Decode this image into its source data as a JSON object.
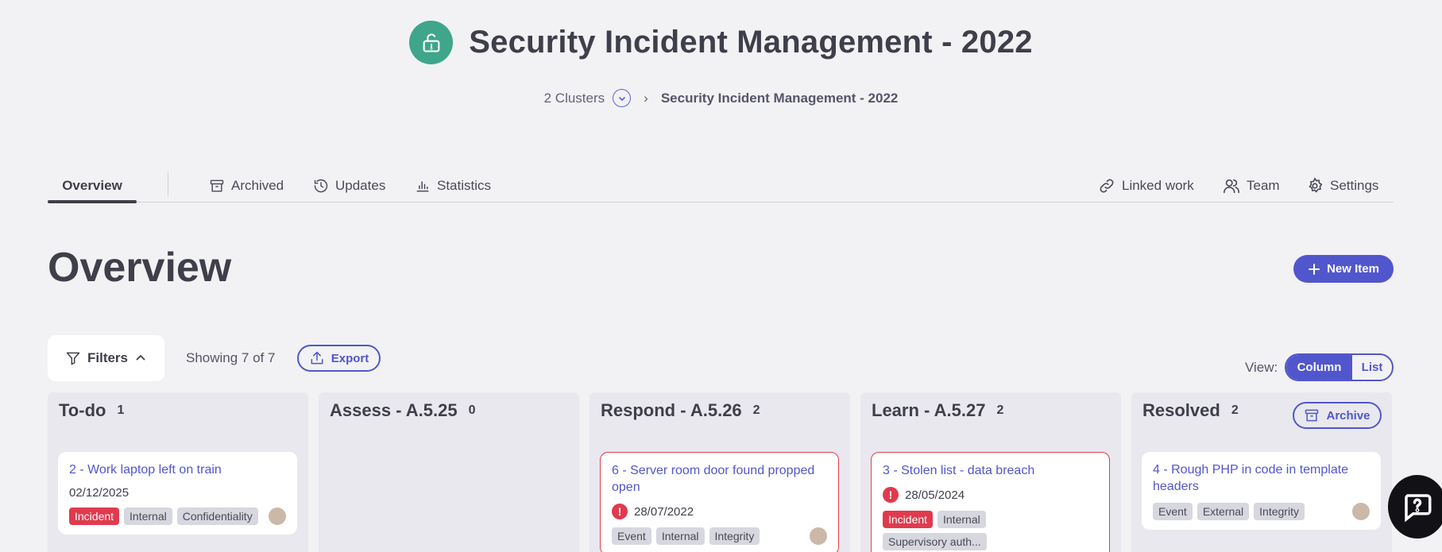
{
  "header": {
    "title": "Security Incident Management - 2022",
    "logo_icon": "unlocked-padlock-icon",
    "logo_color": "#3fa68b"
  },
  "breadcrumb": {
    "clusters": "2 Clusters",
    "separator": "›",
    "current": "Security Incident Management - 2022"
  },
  "tabs": {
    "overview": "Overview",
    "archived": "Archived",
    "updates": "Updates",
    "statistics": "Statistics",
    "linked_work": "Linked work",
    "team": "Team",
    "settings": "Settings"
  },
  "main": {
    "heading": "Overview",
    "new_item": "New Item",
    "filters": "Filters",
    "showing": "Showing 7 of 7",
    "export": "Export",
    "view_label": "View:",
    "view_column": "Column",
    "view_list": "List",
    "accent_color": "#5156cc"
  },
  "columns": [
    {
      "title": "To-do",
      "count": "1",
      "cards": [
        {
          "title": "2 - Work laptop left on train",
          "date": "02/12/2025",
          "tags": [
            "Incident",
            "Internal",
            "Confidentiality"
          ]
        }
      ]
    },
    {
      "title": "Assess - A.5.25",
      "count": "0",
      "cards": []
    },
    {
      "title": "Respond - A.5.26",
      "count": "2",
      "cards": [
        {
          "title": "6 - Server room door found propped open",
          "date": "28/07/2022",
          "tags": [
            "Event",
            "Internal",
            "Integrity"
          ]
        }
      ]
    },
    {
      "title": "Learn - A.5.27",
      "count": "2",
      "cards": [
        {
          "title": "3 - Stolen list - data breach",
          "date": "28/05/2024",
          "tags": [
            "Incident",
            "Internal",
            "Supervisory auth..."
          ]
        }
      ]
    },
    {
      "title": "Resolved",
      "count": "2",
      "archive": "Archive",
      "cards": [
        {
          "title": "4 - Rough PHP in code in template headers",
          "tags": [
            "Event",
            "External",
            "Integrity"
          ]
        }
      ]
    }
  ]
}
